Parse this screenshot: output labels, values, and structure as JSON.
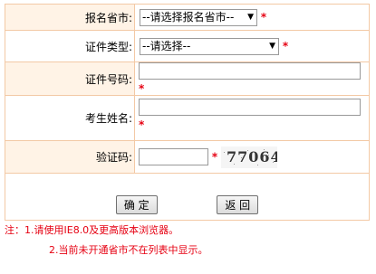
{
  "form": {
    "province": {
      "label": "报名省市:",
      "value": "--请选择报名省市--"
    },
    "id_type": {
      "label": "证件类型:",
      "value": "--请选择--"
    },
    "id_number": {
      "label": "证件号码:",
      "value": ""
    },
    "name": {
      "label": "考生姓名:",
      "value": ""
    },
    "captcha": {
      "label": "验证码:",
      "value": "",
      "image_text": "77064"
    },
    "required_mark": "*"
  },
  "buttons": {
    "confirm": "确 定",
    "back": "返 回"
  },
  "notes": {
    "line1": "注：1.请使用IE8.0及更高版本浏览器。",
    "line2": "2.当前未开通省市不在列表中显示。"
  },
  "colors": {
    "border": "#f3c9a5",
    "label_bg": "#fff3e6",
    "required": "#e60012"
  }
}
